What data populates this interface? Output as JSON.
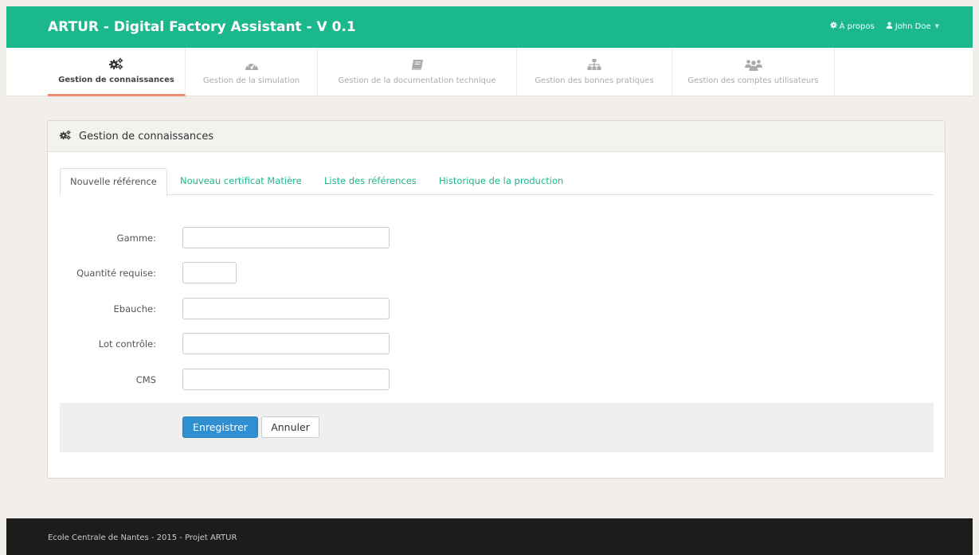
{
  "header": {
    "brand": "ARTUR - Digital Factory Assistant - V 0.1",
    "about_label": "À propos",
    "user_label": "John Doe",
    "about_icon": "gear-icon",
    "user_icon": "user-icon"
  },
  "nav": {
    "items": [
      {
        "label": "Gestion de connaissances",
        "icon": "cogs-icon",
        "active": true
      },
      {
        "label": "Gestion de la simulation",
        "icon": "dashboard-icon",
        "active": false
      },
      {
        "label": "Gestion de la documentation technique",
        "icon": "book-icon",
        "active": false
      },
      {
        "label": "Gestion des bonnes pratiques",
        "icon": "sitemap-icon",
        "active": false
      },
      {
        "label": "Gestion des comptes utilisateurs",
        "icon": "users-icon",
        "active": false
      }
    ]
  },
  "panel": {
    "title": "Gestion de connaissances",
    "tabs": [
      {
        "label": "Nouvelle référence",
        "active": true
      },
      {
        "label": "Nouveau certificat Matière",
        "active": false
      },
      {
        "label": "Liste des références",
        "active": false
      },
      {
        "label": "Historique de la production",
        "active": false
      }
    ],
    "form": {
      "gamme_label": "Gamme:",
      "gamme_value": "",
      "quantite_label": "Quantité requise:",
      "quantite_value": "",
      "ebauche_label": "Ebauche:",
      "ebauche_value": "",
      "lot_label": "Lot contrôle:",
      "lot_value": "",
      "cms_label": "CMS",
      "cms_value": ""
    },
    "actions": {
      "save_label": "Enregistrer",
      "cancel_label": "Annuler"
    }
  },
  "footer": {
    "text": "Ecole Centrale de Nantes - 2015 - Projet ARTUR"
  },
  "colors": {
    "brand_green": "#1ab88c",
    "active_underline": "#f28b74",
    "primary_button": "#2f8fd1",
    "footer_bg": "#1c1c1c"
  }
}
